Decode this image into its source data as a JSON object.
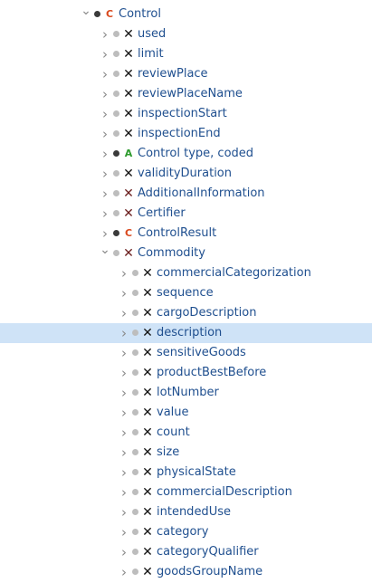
{
  "tree": {
    "nodes": [
      {
        "label": "Control",
        "level": 0,
        "expanded": true,
        "dot": "dark",
        "type": "c",
        "type_glyph": "C",
        "selected": false
      },
      {
        "label": "used",
        "level": 1,
        "expanded": false,
        "dot": "light",
        "type": "x",
        "type_glyph": "✕",
        "selected": false
      },
      {
        "label": "limit",
        "level": 1,
        "expanded": false,
        "dot": "light",
        "type": "x",
        "type_glyph": "✕",
        "selected": false
      },
      {
        "label": "reviewPlace",
        "level": 1,
        "expanded": false,
        "dot": "light",
        "type": "x",
        "type_glyph": "✕",
        "selected": false
      },
      {
        "label": "reviewPlaceName",
        "level": 1,
        "expanded": false,
        "dot": "light",
        "type": "x",
        "type_glyph": "✕",
        "selected": false
      },
      {
        "label": "inspectionStart",
        "level": 1,
        "expanded": false,
        "dot": "light",
        "type": "x",
        "type_glyph": "✕",
        "selected": false
      },
      {
        "label": "inspectionEnd",
        "level": 1,
        "expanded": false,
        "dot": "light",
        "type": "x",
        "type_glyph": "✕",
        "selected": false
      },
      {
        "label": "Control type, coded",
        "level": 1,
        "expanded": false,
        "dot": "dark",
        "type": "a",
        "type_glyph": "A",
        "selected": false
      },
      {
        "label": "validityDuration",
        "level": 1,
        "expanded": false,
        "dot": "light",
        "type": "x",
        "type_glyph": "✕",
        "selected": false
      },
      {
        "label": "AdditionalInformation",
        "level": 1,
        "expanded": false,
        "dot": "light",
        "type": "x-brown",
        "type_glyph": "✕",
        "selected": false
      },
      {
        "label": "Certifier",
        "level": 1,
        "expanded": false,
        "dot": "light",
        "type": "x-brown",
        "type_glyph": "✕",
        "selected": false
      },
      {
        "label": "ControlResult",
        "level": 1,
        "expanded": false,
        "dot": "dark",
        "type": "c",
        "type_glyph": "C",
        "selected": false
      },
      {
        "label": "Commodity",
        "level": 1,
        "expanded": true,
        "dot": "light",
        "type": "x-brown",
        "type_glyph": "✕",
        "selected": false
      },
      {
        "label": "commercialCategorization",
        "level": 2,
        "expanded": false,
        "dot": "light",
        "type": "x",
        "type_glyph": "✕",
        "selected": false
      },
      {
        "label": "sequence",
        "level": 2,
        "expanded": false,
        "dot": "light",
        "type": "x",
        "type_glyph": "✕",
        "selected": false
      },
      {
        "label": "cargoDescription",
        "level": 2,
        "expanded": false,
        "dot": "light",
        "type": "x",
        "type_glyph": "✕",
        "selected": false
      },
      {
        "label": "description",
        "level": 2,
        "expanded": false,
        "dot": "light",
        "type": "x",
        "type_glyph": "✕",
        "selected": true
      },
      {
        "label": "sensitiveGoods",
        "level": 2,
        "expanded": false,
        "dot": "light",
        "type": "x",
        "type_glyph": "✕",
        "selected": false
      },
      {
        "label": "productBestBefore",
        "level": 2,
        "expanded": false,
        "dot": "light",
        "type": "x",
        "type_glyph": "✕",
        "selected": false
      },
      {
        "label": "lotNumber",
        "level": 2,
        "expanded": false,
        "dot": "light",
        "type": "x",
        "type_glyph": "✕",
        "selected": false
      },
      {
        "label": "value",
        "level": 2,
        "expanded": false,
        "dot": "light",
        "type": "x",
        "type_glyph": "✕",
        "selected": false
      },
      {
        "label": "count",
        "level": 2,
        "expanded": false,
        "dot": "light",
        "type": "x",
        "type_glyph": "✕",
        "selected": false
      },
      {
        "label": "size",
        "level": 2,
        "expanded": false,
        "dot": "light",
        "type": "x",
        "type_glyph": "✕",
        "selected": false
      },
      {
        "label": "physicalState",
        "level": 2,
        "expanded": false,
        "dot": "light",
        "type": "x",
        "type_glyph": "✕",
        "selected": false
      },
      {
        "label": "commercialDescription",
        "level": 2,
        "expanded": false,
        "dot": "light",
        "type": "x",
        "type_glyph": "✕",
        "selected": false
      },
      {
        "label": "intendedUse",
        "level": 2,
        "expanded": false,
        "dot": "light",
        "type": "x",
        "type_glyph": "✕",
        "selected": false
      },
      {
        "label": "category",
        "level": 2,
        "expanded": false,
        "dot": "light",
        "type": "x",
        "type_glyph": "✕",
        "selected": false
      },
      {
        "label": "categoryQualifier",
        "level": 2,
        "expanded": false,
        "dot": "light",
        "type": "x",
        "type_glyph": "✕",
        "selected": false
      },
      {
        "label": "goodsGroupName",
        "level": 2,
        "expanded": false,
        "dot": "light",
        "type": "x",
        "type_glyph": "✕",
        "selected": false
      }
    ]
  },
  "icons": {
    "chevron_closed": "chevron-right-icon",
    "chevron_open": "chevron-down-icon",
    "status_dot": "status-dot-icon",
    "element": "element-x-icon",
    "complex": "class-c-icon",
    "attribute": "attribute-a-icon"
  },
  "colors": {
    "label": "#1f4f8f",
    "selection": "#cfe3f7",
    "class_icon": "#d9481c",
    "attribute_icon": "#2e9b2e",
    "element_icon": "#111111",
    "element_icon_brown": "#6b1e1e"
  }
}
